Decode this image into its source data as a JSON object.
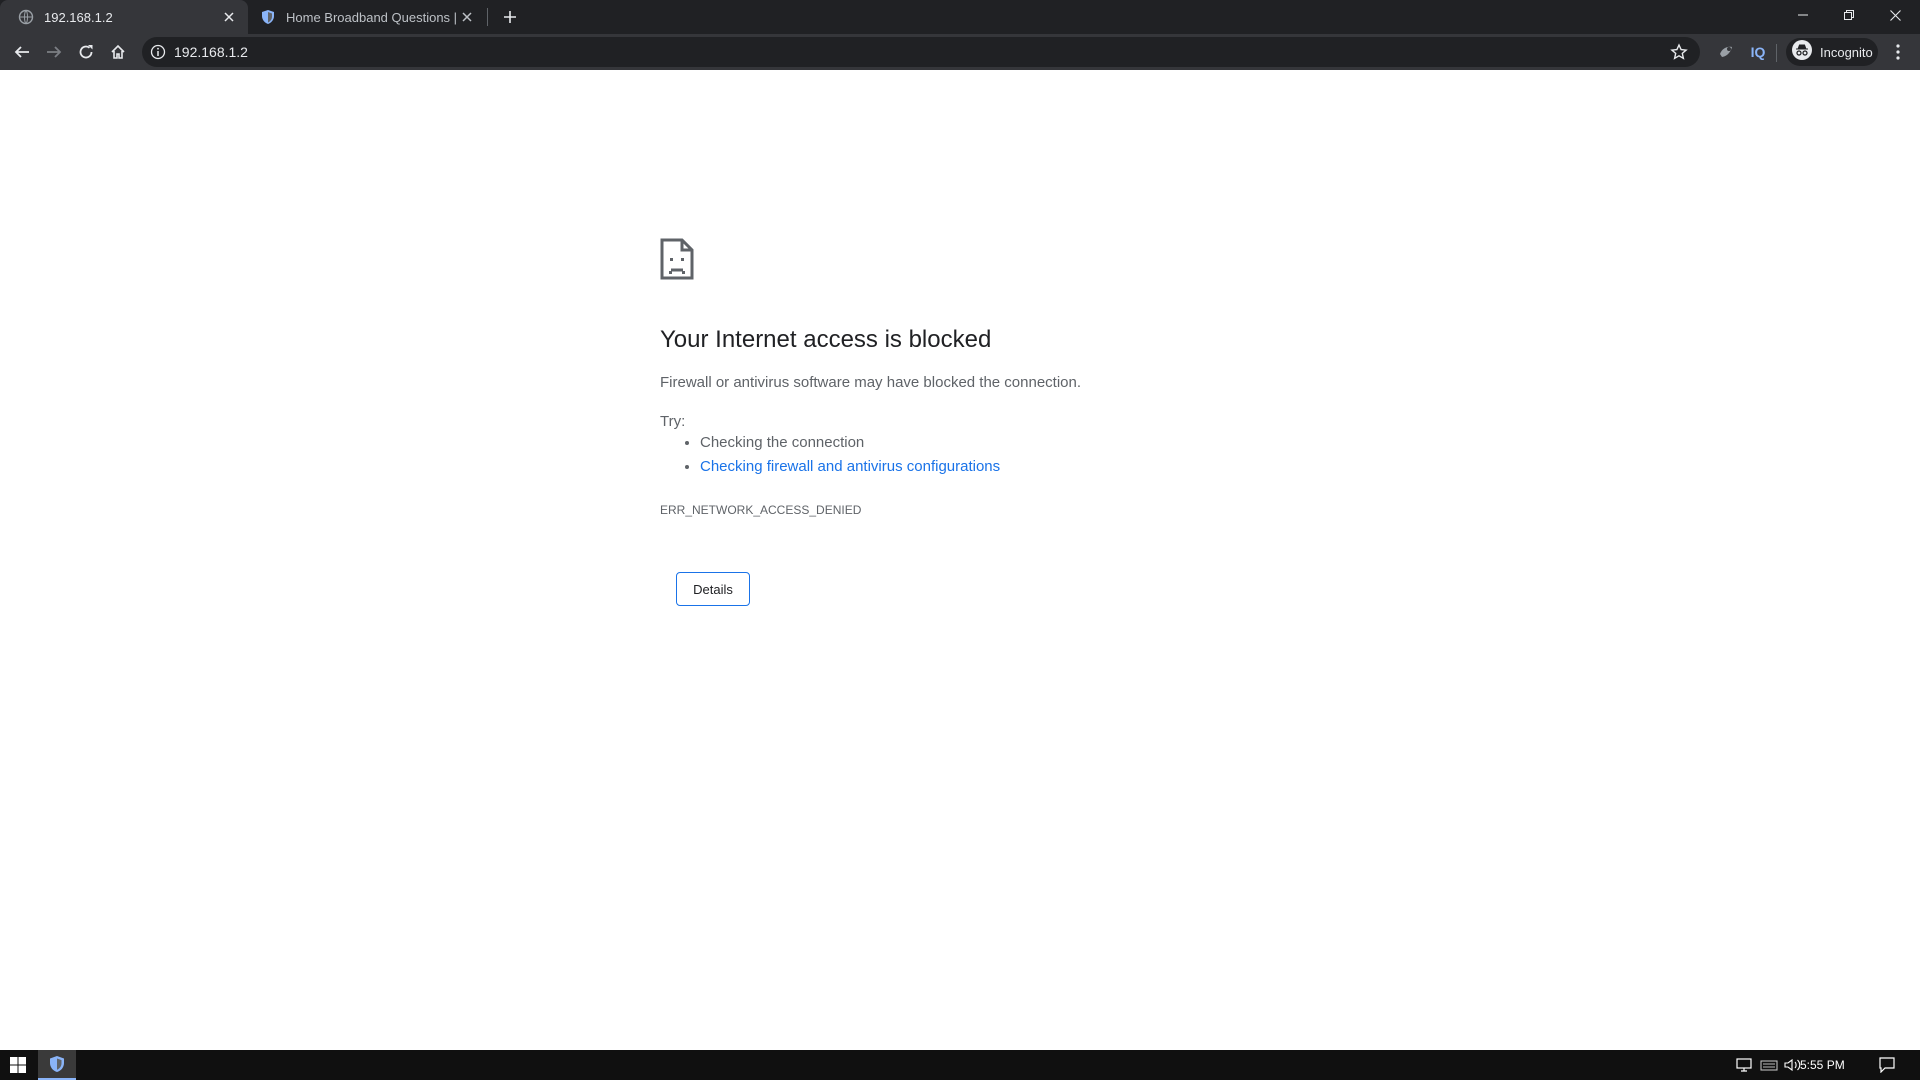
{
  "browser": {
    "tabs": [
      {
        "title": "192.168.1.2",
        "active": true,
        "favicon": "globe-icon"
      },
      {
        "title": "Home Broadband Questions | Pir",
        "active": false,
        "favicon": "shield-favicon-icon"
      }
    ],
    "address_bar": {
      "url": "192.168.1.2"
    },
    "extensions": {
      "iq_label": "IQ"
    },
    "profile": {
      "label": "Incognito"
    }
  },
  "error_page": {
    "heading": "Your Internet access is blocked",
    "description": "Firewall or antivirus software may have blocked the connection.",
    "try_label": "Try:",
    "suggestions": [
      {
        "text": "Checking the connection",
        "is_link": false
      },
      {
        "text": "Checking firewall and antivirus configurations",
        "is_link": true
      }
    ],
    "error_code": "ERR_NETWORK_ACCESS_DENIED",
    "details_button": "Details"
  },
  "taskbar": {
    "clock": "5:55 PM"
  },
  "colors": {
    "link": "#1a73e8",
    "chrome_dark": "#35363a",
    "tabstrip": "#202124"
  }
}
